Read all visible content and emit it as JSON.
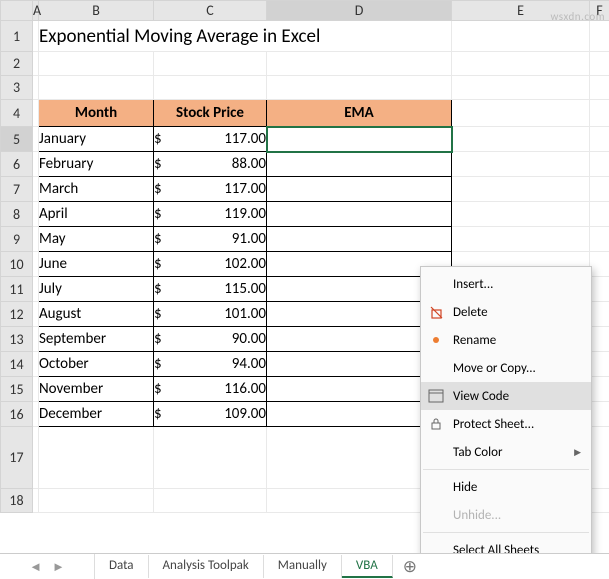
{
  "title": "Exponential Moving Average in Excel",
  "columns": [
    "A",
    "B",
    "C",
    "D",
    "E",
    "F"
  ],
  "row_numbers": [
    "1",
    "2",
    "3",
    "4",
    "5",
    "6",
    "7",
    "8",
    "9",
    "10",
    "11",
    "12",
    "13",
    "14",
    "15",
    "16",
    "17",
    "18"
  ],
  "headers": {
    "month": "Month",
    "price": "Stock Price",
    "ema": "EMA"
  },
  "data_rows": [
    {
      "month": "January",
      "currency": "$",
      "price": "117.00"
    },
    {
      "month": "February",
      "currency": "$",
      "price": "88.00"
    },
    {
      "month": "March",
      "currency": "$",
      "price": "117.00"
    },
    {
      "month": "April",
      "currency": "$",
      "price": "119.00"
    },
    {
      "month": "May",
      "currency": "$",
      "price": "91.00"
    },
    {
      "month": "June",
      "currency": "$",
      "price": "102.00"
    },
    {
      "month": "July",
      "currency": "$",
      "price": "115.00"
    },
    {
      "month": "August",
      "currency": "$",
      "price": "101.00"
    },
    {
      "month": "September",
      "currency": "$",
      "price": "90.00"
    },
    {
      "month": "October",
      "currency": "$",
      "price": "94.00"
    },
    {
      "month": "November",
      "currency": "$",
      "price": "116.00"
    },
    {
      "month": "December",
      "currency": "$",
      "price": "109.00"
    }
  ],
  "tabs": [
    "Data",
    "Analysis Toolpak",
    "Manually",
    "VBA"
  ],
  "active_tab_index": 3,
  "context_menu": {
    "insert": "Insert...",
    "delete": "Delete",
    "rename": "Rename",
    "move_copy": "Move or Copy...",
    "view_code": "View Code",
    "protect": "Protect Sheet...",
    "tab_color": "Tab Color",
    "hide": "Hide",
    "unhide": "Unhide...",
    "select_all": "Select All Sheets"
  },
  "selected_cell": "D5",
  "watermark": "wsxdn.com"
}
